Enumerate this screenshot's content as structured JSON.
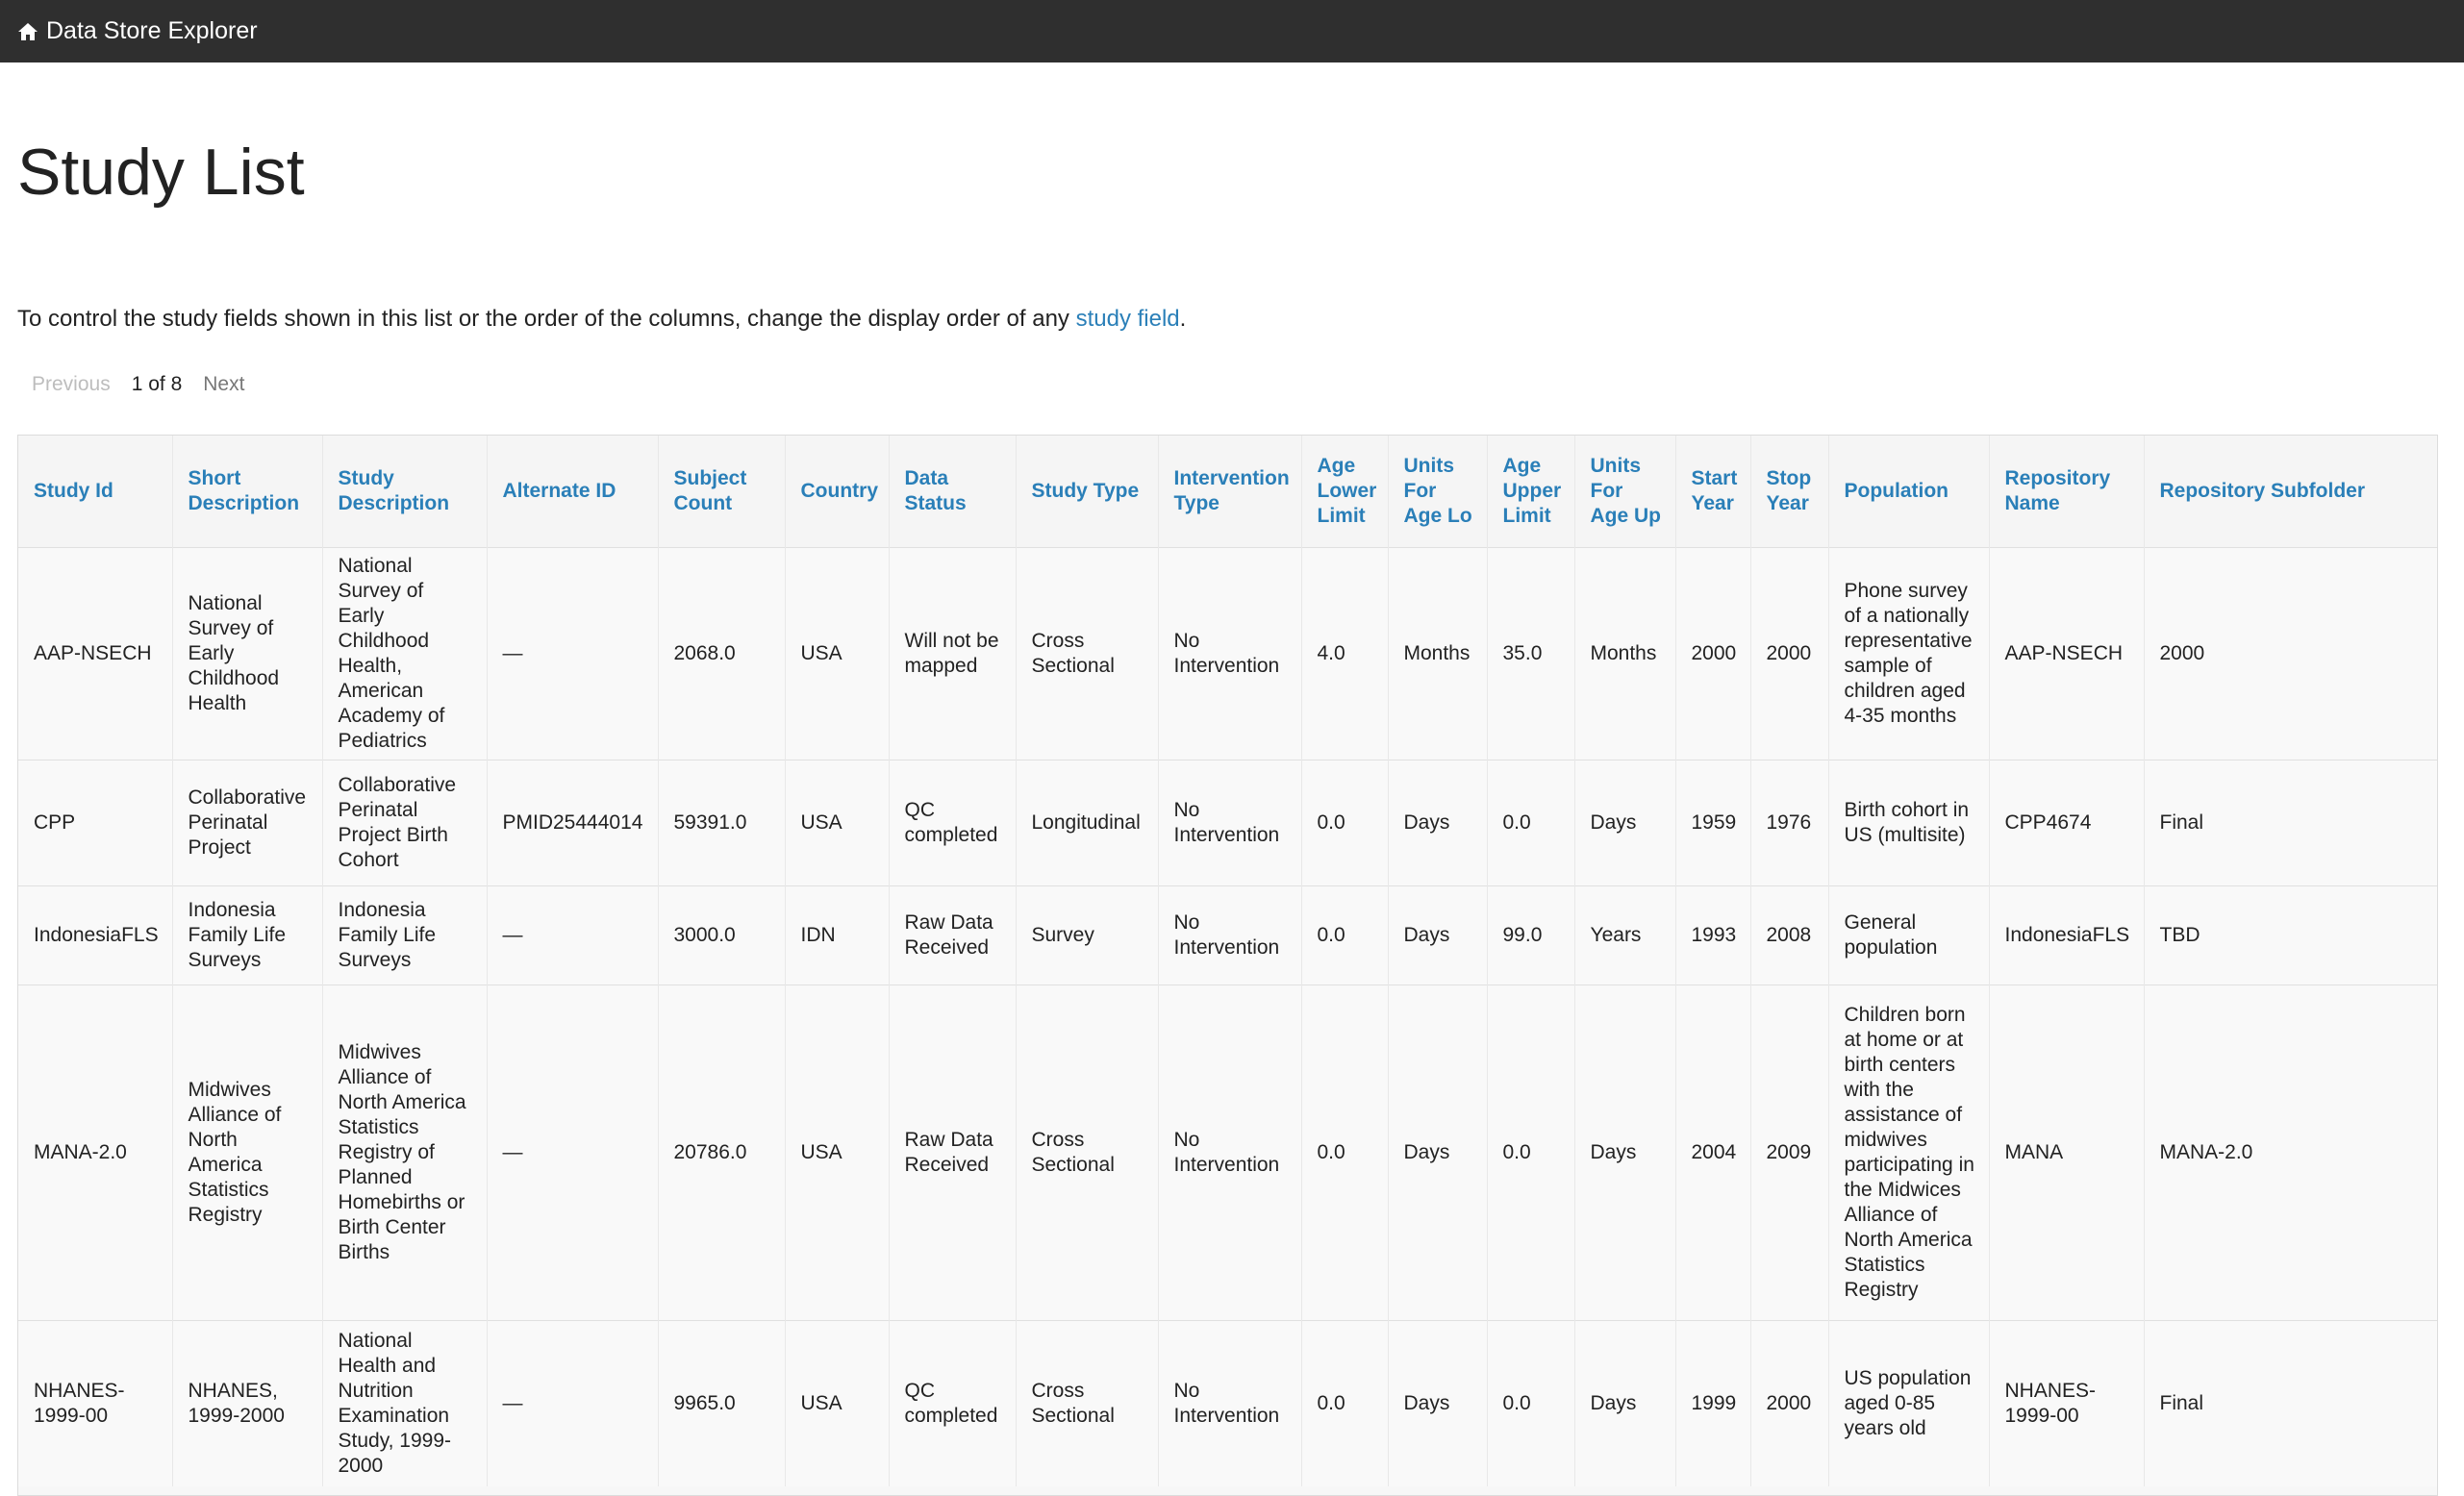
{
  "nav": {
    "brand": "Data Store Explorer",
    "icon": "home-icon"
  },
  "page": {
    "title": "Study List",
    "intro_prefix": "To control the study fields shown in this list or the order of the columns, change the display order of any ",
    "intro_link": "study field",
    "intro_suffix": "."
  },
  "pagination": {
    "previous": "Previous",
    "info": "1 of 8",
    "next": "Next"
  },
  "colors": {
    "navbar": "#2f2f2f",
    "link": "#2a7fb8",
    "header_text": "#2a7fb8"
  },
  "table": {
    "columns": [
      "Study Id",
      "Short Description",
      "Study Description",
      "Alternate ID",
      "Subject Count",
      "Country",
      "Data Status",
      "Study Type",
      "Intervention Type",
      "Age Lower Limit",
      "Units For Age Lo",
      "Age Upper Limit",
      "Units For Age Up",
      "Start Year",
      "Stop Year",
      "Population",
      "Repository Name",
      "Repository Subfolder"
    ],
    "rows": [
      [
        "AAP-NSECH",
        "National Survey of Early Childhood Health",
        "National Survey of Early Childhood Health, American Academy of Pediatrics",
        "—",
        "2068.0",
        "USA",
        "Will not be mapped",
        "Cross Sectional",
        "No Intervention",
        "4.0",
        "Months",
        "35.0",
        "Months",
        "2000",
        "2000",
        "Phone survey of a nationally representative sample of children aged 4-35 months",
        "AAP-NSECH",
        "2000"
      ],
      [
        "CPP",
        "Collaborative Perinatal Project",
        "Collaborative Perinatal Project Birth Cohort",
        "PMID25444014",
        "59391.0",
        "USA",
        "QC completed",
        "Longitudinal",
        "No Intervention",
        "0.0",
        "Days",
        "0.0",
        "Days",
        "1959",
        "1976",
        "Birth cohort in US (multisite)",
        "CPP4674",
        "Final"
      ],
      [
        "IndonesiaFLS",
        "Indonesia Family Life Surveys",
        "Indonesia Family Life Surveys",
        "—",
        "3000.0",
        "IDN",
        "Raw Data Received",
        "Survey",
        "No Intervention",
        "0.0",
        "Days",
        "99.0",
        "Years",
        "1993",
        "2008",
        "General population",
        "IndonesiaFLS",
        "TBD"
      ],
      [
        "MANA-2.0",
        "Midwives Alliance of North America Statistics Registry",
        "Midwives Alliance of North America Statistics Registry of Planned Homebirths or Birth Center Births",
        "—",
        "20786.0",
        "USA",
        "Raw Data Received",
        "Cross Sectional",
        "No Intervention",
        "0.0",
        "Days",
        "0.0",
        "Days",
        "2004",
        "2009",
        "Children born at home or at birth centers with the assistance of midwives participating in the Midwices Alliance of North America Statistics Registry",
        "MANA",
        "MANA-2.0"
      ],
      [
        "NHANES-1999-00",
        "NHANES, 1999-2000",
        "National Health and Nutrition Examination Study, 1999-2000",
        "—",
        "9965.0",
        "USA",
        "QC completed",
        "Cross Sectional",
        "No Intervention",
        "0.0",
        "Days",
        "0.0",
        "Days",
        "1999",
        "2000",
        "US population aged 0-85 years old",
        "NHANES-1999-00",
        "Final"
      ]
    ]
  }
}
